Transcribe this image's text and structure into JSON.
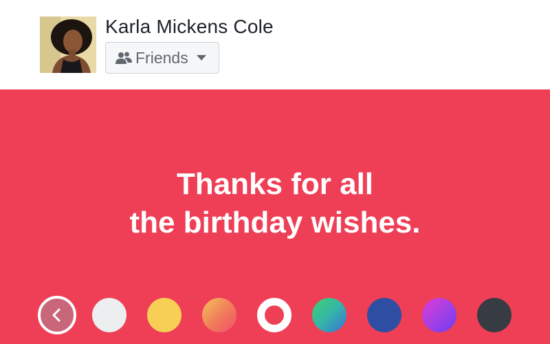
{
  "header": {
    "user_name": "Karla Mickens Cole",
    "audience_label": "Friends",
    "audience_icon": "friends-icon",
    "dropdown_icon": "caret-down-icon"
  },
  "post": {
    "text": "Thanks for all\nthe birthday wishes.",
    "background_color": "#ef3f56",
    "text_color": "#ffffff"
  },
  "palette": {
    "back_icon": "chevron-left-icon",
    "swatches": [
      {
        "name": "white",
        "color": "#eceef0"
      },
      {
        "name": "yellow",
        "color": "#f7cf55"
      },
      {
        "name": "orange-gradient",
        "color": "#f5a25a"
      },
      {
        "name": "selected-red",
        "color": "#ef3f56",
        "selected": true
      },
      {
        "name": "green-blue-gradient",
        "color": "#3cb6a4"
      },
      {
        "name": "blue",
        "color": "#2d4ea3"
      },
      {
        "name": "purple-gradient",
        "color": "#a640e5"
      },
      {
        "name": "dark-gray",
        "color": "#373b42"
      }
    ]
  }
}
